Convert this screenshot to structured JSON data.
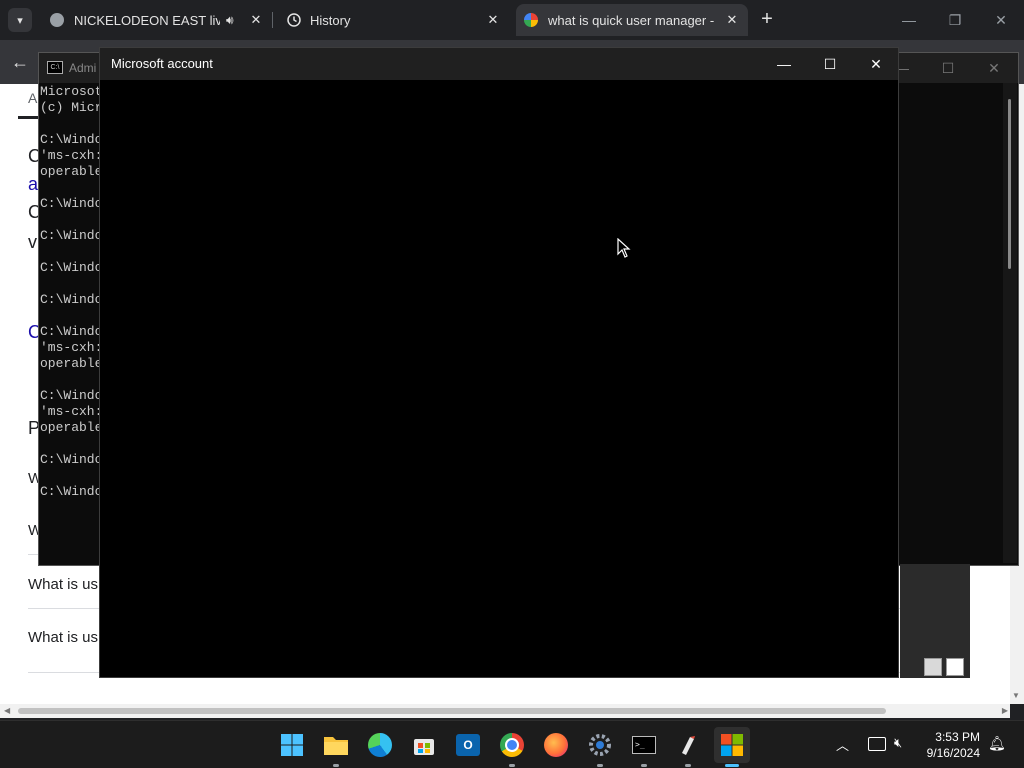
{
  "browser": {
    "tabs": [
      {
        "title": "NICKELODEON EAST live st",
        "icon": "globe-icon",
        "audio": true
      },
      {
        "title": "History",
        "icon": "history-icon"
      },
      {
        "title": "what is quick user manager - G",
        "icon": "google-icon",
        "active": true
      }
    ],
    "new_tab_symbol": "+"
  },
  "page_behind": {
    "lines": [
      "A",
      "C",
      "a",
      "C",
      "v",
      "C",
      "P",
      "W",
      "W",
      "What is us",
      "What is us"
    ]
  },
  "cmd": {
    "title": "Admi",
    "lines": [
      "Microsot",
      "(c) Micr",
      "C:\\Windo",
      "'ms-cxh:",
      "operable",
      "C:\\Windo",
      "C:\\Windo",
      "C:\\Windo",
      "C:\\Windo",
      "C:\\Windo",
      "'ms-cxh:",
      "operable",
      "C:\\Windo",
      "'ms-cxh:",
      "operable",
      "C:\\Windo",
      "C:\\Windo"
    ]
  },
  "account_window": {
    "title": "Microsoft account"
  },
  "taskbar": {
    "apps": [
      "windows-start-icon",
      "file-explorer-icon",
      "edge-icon",
      "store-icon",
      "outlook-icon",
      "chrome-icon",
      "firefox-icon",
      "settings-icon",
      "terminal-icon",
      "paint-icon",
      "microsoft-logo-icon"
    ],
    "time": "3:53 PM",
    "date": "9/16/2024"
  }
}
